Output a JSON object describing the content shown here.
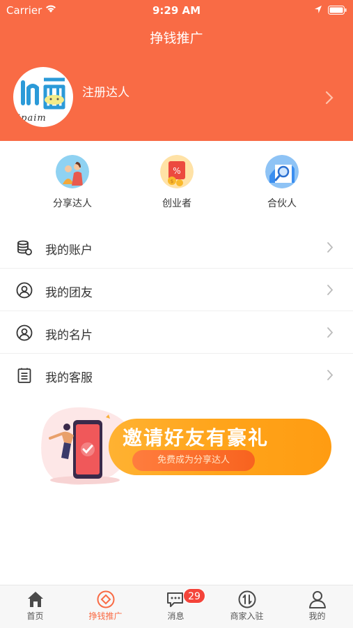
{
  "status_bar": {
    "carrier": "Carrier",
    "time": "9:29 AM"
  },
  "header": {
    "title": "挣钱推广",
    "avatar_text": "ipaim",
    "user_label": "注册达人",
    "bg_color": "#f96b45"
  },
  "categories": [
    {
      "label": "分享达人",
      "icon": "share-person-icon"
    },
    {
      "label": "创业者",
      "icon": "red-envelope-icon"
    },
    {
      "label": "合伙人",
      "icon": "magnifier-icon"
    }
  ],
  "menu": [
    {
      "label": "我的账户",
      "icon": "coins-stack-icon"
    },
    {
      "label": "我的团友",
      "icon": "user-circle-icon"
    },
    {
      "label": "我的名片",
      "icon": "user-circle-icon"
    },
    {
      "label": "我的客服",
      "icon": "clipboard-icon"
    }
  ],
  "banner": {
    "title": "邀请好友有豪礼",
    "subtitle": "免费成为分享达人"
  },
  "tabbar": {
    "items": [
      {
        "label": "首页",
        "icon": "home-icon",
        "active": false
      },
      {
        "label": "挣钱推广",
        "icon": "promote-icon",
        "active": true
      },
      {
        "label": "消息",
        "icon": "chat-icon",
        "active": false
      },
      {
        "label": "商家入驻",
        "icon": "merchant-icon",
        "active": false
      },
      {
        "label": "我的",
        "icon": "person-icon",
        "active": false
      }
    ],
    "message_badge": "29",
    "accent_color": "#f96b45"
  }
}
